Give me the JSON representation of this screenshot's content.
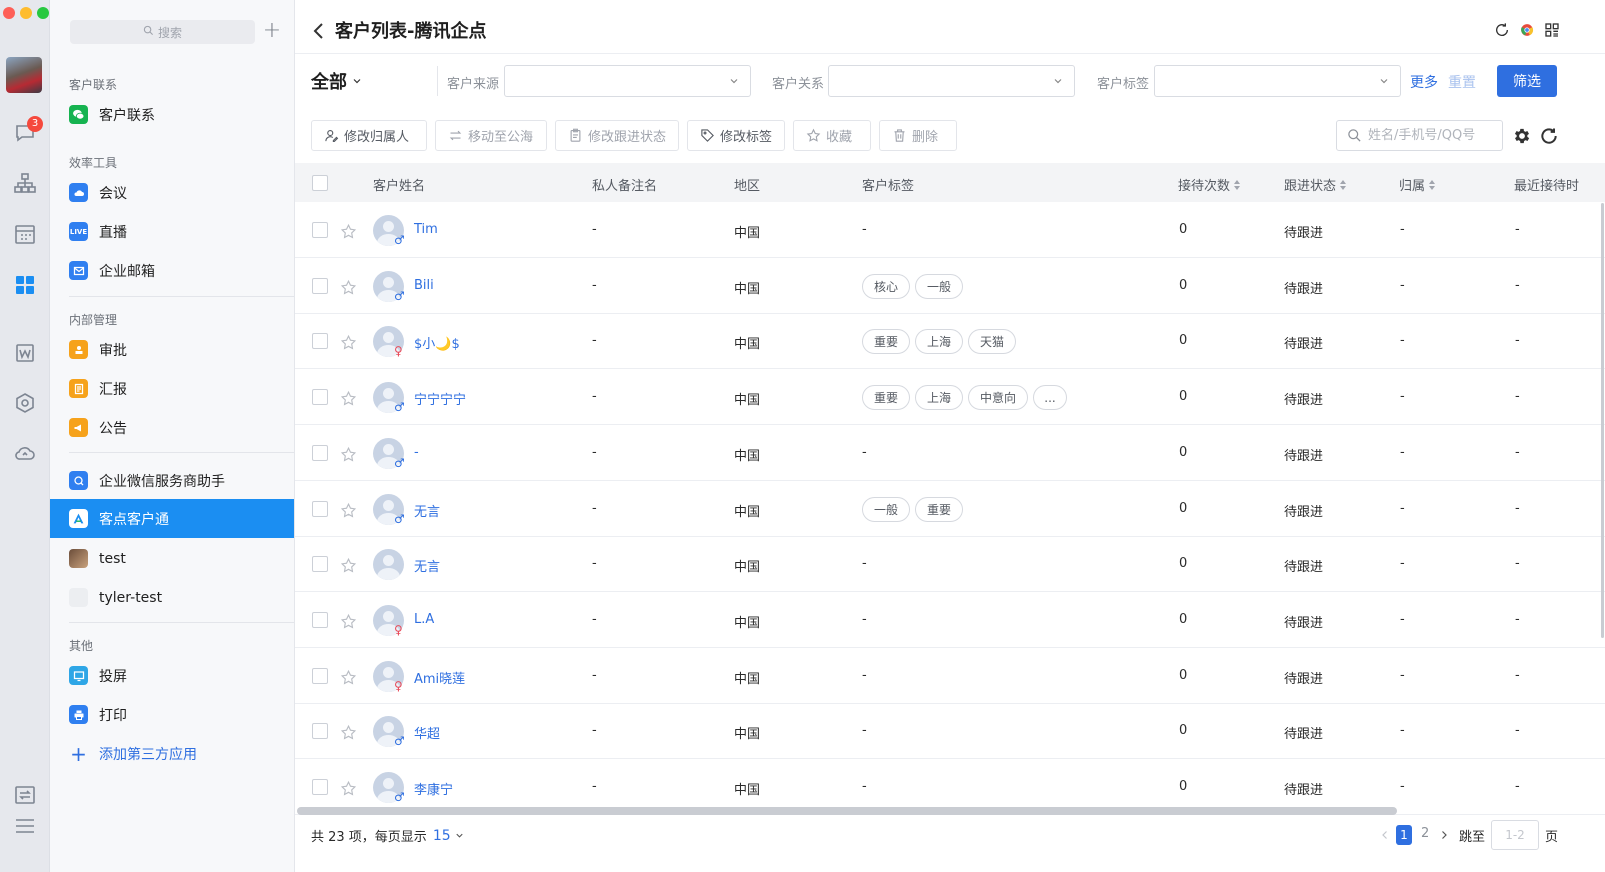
{
  "app": {
    "title": "客户列表-腾讯企点",
    "badge_count": "3",
    "colors": {
      "accent": "#2f6fe0",
      "active_bg": "#1b8ef2",
      "badge": "#f5493d"
    }
  },
  "rail_icons": [
    "messages-icon",
    "contacts-icon",
    "calendar-icon",
    "workbench-icon",
    "docs-icon",
    "cube-icon",
    "cloud-icon",
    "transfer-icon",
    "menu-icon"
  ],
  "sidebar": {
    "search_placeholder": "搜索",
    "sections": {
      "contacts": "客户联系",
      "efficiency": "效率工具",
      "internal": "内部管理",
      "other": "其他"
    },
    "items": {
      "contacts": "客户联系",
      "meeting": "会议",
      "live": "直播",
      "live_icon_text": "LIVE",
      "mail": "企业邮箱",
      "approval": "审批",
      "report": "汇报",
      "notice": "公告",
      "wecom_helper": "企业微信服务商助手",
      "kedian": "客点客户通",
      "test": "test",
      "tyler_test": "tyler-test",
      "screencast": "投屏",
      "print": "打印"
    },
    "add_app": "添加第三方应用"
  },
  "filters": {
    "scope": "全部",
    "source_label": "客户来源",
    "relation_label": "客户关系",
    "tag_label": "客户标签",
    "more": "更多",
    "reset": "重置",
    "filter_button": "筛选"
  },
  "actions": {
    "change_owner": "修改归属人",
    "move_to_pool": "移动至公海",
    "change_status": "修改跟进状态",
    "change_tags": "修改标签",
    "favorite": "收藏",
    "delete": "删除",
    "search_placeholder": "姓名/手机号/QQ号"
  },
  "table": {
    "columns": {
      "name": "客户姓名",
      "remark": "私人备注名",
      "region": "地区",
      "tags": "客户标签",
      "visits": "接待次数",
      "status": "跟进状态",
      "owner": "归属",
      "last": "最近接待时"
    },
    "rows": [
      {
        "name": "Tim",
        "gender": "♂",
        "remark": "-",
        "region": "中国",
        "tags_text": "-",
        "tags": [],
        "visits": "0",
        "status": "待跟进",
        "owner": "-",
        "last": "-"
      },
      {
        "name": "Bili",
        "gender": "♂",
        "remark": "-",
        "region": "中国",
        "tags_text": "",
        "tags": [
          "核心",
          "一般"
        ],
        "visits": "0",
        "status": "待跟进",
        "owner": "-",
        "last": "-"
      },
      {
        "name": "$小🌙$",
        "gender": "♀",
        "remark": "-",
        "region": "中国",
        "tags_text": "",
        "tags": [
          "重要",
          "上海",
          "天猫"
        ],
        "visits": "0",
        "status": "待跟进",
        "owner": "-",
        "last": "-"
      },
      {
        "name": "宁宁宁宁",
        "gender": "♂",
        "remark": "-",
        "region": "中国",
        "tags_text": "",
        "tags": [
          "重要",
          "上海",
          "中意向",
          "..."
        ],
        "visits": "0",
        "status": "待跟进",
        "owner": "-",
        "last": "-"
      },
      {
        "name": "-",
        "gender": "♂",
        "remark": "-",
        "region": "中国",
        "tags_text": "-",
        "tags": [],
        "visits": "0",
        "status": "待跟进",
        "owner": "-",
        "last": "-"
      },
      {
        "name": "无言",
        "gender": "♂",
        "remark": "-",
        "region": "中国",
        "tags_text": "",
        "tags": [
          "一般",
          "重要"
        ],
        "visits": "0",
        "status": "待跟进",
        "owner": "-",
        "last": "-"
      },
      {
        "name": "无言",
        "gender": "",
        "remark": "-",
        "region": "中国",
        "tags_text": "-",
        "tags": [],
        "visits": "0",
        "status": "待跟进",
        "owner": "-",
        "last": "-"
      },
      {
        "name": "L.A",
        "gender": "♀",
        "remark": "-",
        "region": "中国",
        "tags_text": "-",
        "tags": [],
        "visits": "0",
        "status": "待跟进",
        "owner": "-",
        "last": "-"
      },
      {
        "name": "Ami晓莲",
        "gender": "♀",
        "remark": "-",
        "region": "中国",
        "tags_text": "-",
        "tags": [],
        "visits": "0",
        "status": "待跟进",
        "owner": "-",
        "last": "-"
      },
      {
        "name": "华超",
        "gender": "♂",
        "remark": "-",
        "region": "中国",
        "tags_text": "-",
        "tags": [],
        "visits": "0",
        "status": "待跟进",
        "owner": "-",
        "last": "-"
      },
      {
        "name": "李康宁",
        "gender": "♂",
        "remark": "-",
        "region": "中国",
        "tags_text": "-",
        "tags": [],
        "visits": "0",
        "status": "待跟进",
        "owner": "-",
        "last": "-"
      }
    ]
  },
  "footer": {
    "total_text": "共 23 项，每页显示",
    "page_size": "15",
    "current_page": "1",
    "next_page": "2",
    "jump_label": "跳至",
    "jump_placeholder": "1-2",
    "page_unit": "页"
  }
}
